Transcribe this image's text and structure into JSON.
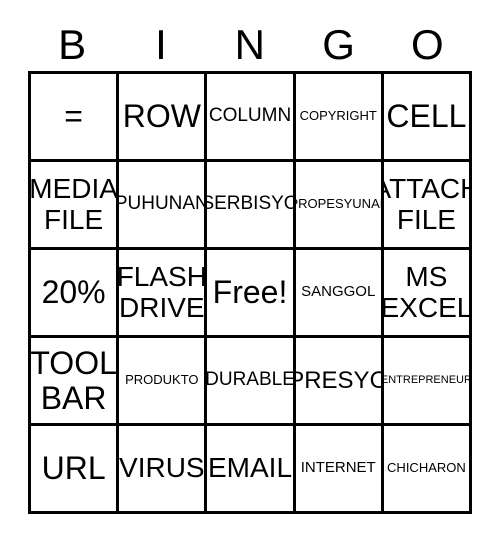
{
  "card": {
    "title": "BINGO",
    "background_color": "#ffffff",
    "line_color": "#000000",
    "text_color": "#000000",
    "header": {
      "letters": [
        "B",
        "I",
        "N",
        "G",
        "O"
      ]
    },
    "grid": {
      "columns": 5,
      "rows": 5,
      "cells": [
        [
          {
            "label": "=",
            "size": "sz-xxl"
          },
          {
            "label": "ROW",
            "size": "sz-xxl"
          },
          {
            "label": "COLUMN",
            "size": "sz-md"
          },
          {
            "label": "COPYRIGHT",
            "size": "sz-xs"
          },
          {
            "label": "CELL",
            "size": "sz-xxl"
          }
        ],
        [
          {
            "label": "MEDIA\nFILE",
            "size": "sz-xl"
          },
          {
            "label": "PUHUNAN",
            "size": "sz-md"
          },
          {
            "label": "SERBISYO",
            "size": "sz-md"
          },
          {
            "label": "PROPESYUNAL",
            "size": "sz-xs"
          },
          {
            "label": "ATTACH\nFILE",
            "size": "sz-xl"
          }
        ],
        [
          {
            "label": "20%",
            "size": "sz-xxl"
          },
          {
            "label": "FLASH\nDRIVE",
            "size": "sz-xl"
          },
          {
            "label": "Free!",
            "size": "sz-xxl"
          },
          {
            "label": "SANGGOL",
            "size": "sz-sm"
          },
          {
            "label": "MS\nEXCEL",
            "size": "sz-xl"
          }
        ],
        [
          {
            "label": "TOOL\nBAR",
            "size": "sz-xxl"
          },
          {
            "label": "PRODUKTO",
            "size": "sz-xs"
          },
          {
            "label": "DURABLE",
            "size": "sz-md"
          },
          {
            "label": "PRESYO",
            "size": "sz-lg"
          },
          {
            "label": "ENTREPRENEUR",
            "size": "sz-xxs"
          }
        ],
        [
          {
            "label": "URL",
            "size": "sz-xxl"
          },
          {
            "label": "VIRUS",
            "size": "sz-xl"
          },
          {
            "label": "EMAIL",
            "size": "sz-xl"
          },
          {
            "label": "INTERNET",
            "size": "sz-sm"
          },
          {
            "label": "CHICHARON",
            "size": "sz-xs"
          }
        ]
      ]
    },
    "free_space": {
      "row": 2,
      "column": 2,
      "label": "Free!"
    }
  }
}
